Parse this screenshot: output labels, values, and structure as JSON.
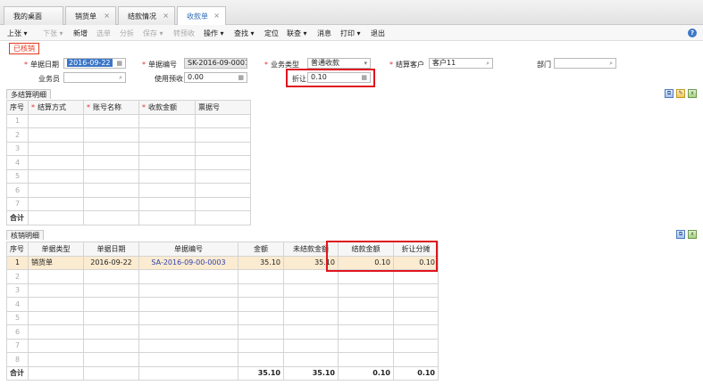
{
  "tabs": [
    {
      "label": "我的桌面",
      "closable": false,
      "active": false
    },
    {
      "label": "销货单",
      "closable": true,
      "active": false
    },
    {
      "label": "结款情况",
      "closable": true,
      "active": false
    },
    {
      "label": "收款单",
      "closable": true,
      "active": true
    }
  ],
  "close_glyph": "×",
  "toolbar": {
    "prev": "上张",
    "next": "下张",
    "add": "新增",
    "select_order": "选单",
    "split": "分拆",
    "save": "保存",
    "convert_prepay": "转预收",
    "operate": "操作",
    "find": "查找",
    "locate": "定位",
    "linked_query": "联查",
    "message": "消息",
    "print": "打印",
    "exit": "退出"
  },
  "status_badge": "已核销",
  "form": {
    "date_label": "单据日期",
    "date_value": "2016-09-22",
    "bill_no_label": "单据编号",
    "bill_no_value": "SK-2016-09-0001",
    "biz_type_label": "业务类型",
    "biz_type_value": "普通收款",
    "customer_label": "结算客户",
    "customer_value": "客户11",
    "dept_label": "部门",
    "dept_value": "",
    "salesman_label": "业务员",
    "salesman_value": "",
    "prepay_label": "使用预收",
    "prepay_value": "0.00",
    "discount_label": "折让",
    "discount_value": "0.10"
  },
  "settlement": {
    "section_title": "多结算明细",
    "headers": [
      "序号",
      "结算方式",
      "账号名称",
      "收款金额",
      "票据号"
    ],
    "required_headers": [
      false,
      true,
      true,
      true,
      false
    ],
    "row_numbers": [
      "1",
      "2",
      "3",
      "4",
      "5",
      "6",
      "7"
    ],
    "total_label": "合计"
  },
  "writeoff": {
    "section_title": "核销明细",
    "headers": [
      "序号",
      "单据类型",
      "单据日期",
      "单据编号",
      "金额",
      "未结款金额",
      "结款金额",
      "折让分摊"
    ],
    "rows": [
      {
        "no": "1",
        "type": "销货单",
        "date": "2016-09-22",
        "bill_no": "SA-2016-09-00-0003",
        "amount": "35.10",
        "unpaid": "35.10",
        "paid": "0.10",
        "discount_alloc": "0.10"
      }
    ],
    "empty_row_numbers": [
      "2",
      "3",
      "4",
      "5",
      "6",
      "7",
      "8"
    ],
    "total_label": "合计",
    "totals": {
      "amount": "35.10",
      "unpaid": "35.10",
      "paid": "0.10",
      "discount_alloc": "0.10"
    }
  },
  "colors": {
    "highlight": "#e0141e",
    "selected_row": "#fbebd0",
    "active_tab": "#2d6cb4"
  }
}
